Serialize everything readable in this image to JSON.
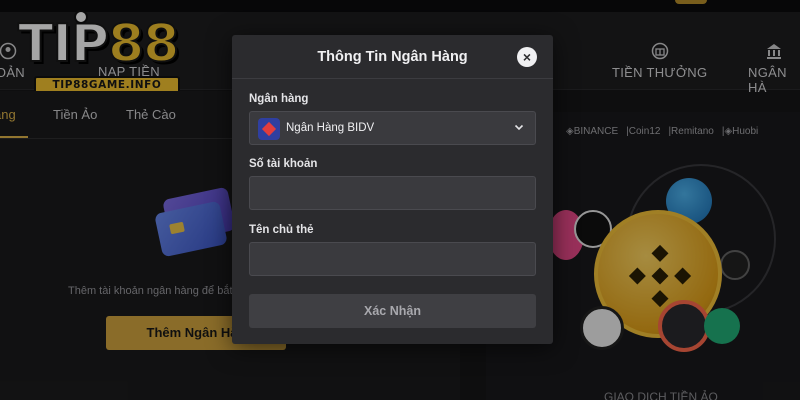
{
  "logo": {
    "main_white": "TIP",
    "main_gold": "88",
    "sub": "TIP88GAME.INFO"
  },
  "nav": {
    "account": "IOẢN",
    "deposit": "NẠP TIỀN",
    "bonus": "TIỀN THƯỞNG",
    "bank": "NGÂN HÀ"
  },
  "tabs": {
    "bank": "àng",
    "crypto": "Tiền Ảo",
    "card": "Thẻ Cào"
  },
  "empty_state": {
    "text": "Thêm tài khoản ngân hàng để bắt đầ",
    "button": "Thêm Ngân Hàn"
  },
  "promo": {
    "partners": [
      "◈BINANCE",
      "|Coin12",
      "|Remitano",
      "|◈Huobi"
    ],
    "caption": "GIAO DỊCH TIỀN ẢO"
  },
  "modal": {
    "title": "Thông Tin Ngân Hàng",
    "close": "×",
    "bank_label": "Ngân hàng",
    "bank_value": "Ngân Hàng BIDV",
    "account_label": "Số tài khoản",
    "account_value": "",
    "holder_label": "Tên chủ thẻ",
    "holder_value": "",
    "submit": "Xác Nhận"
  },
  "colors": {
    "accent_gold": "#d4a73f",
    "modal_bg": "#2b2b2e",
    "field_bg": "#3a3a3e",
    "page_bg": "#161618"
  }
}
